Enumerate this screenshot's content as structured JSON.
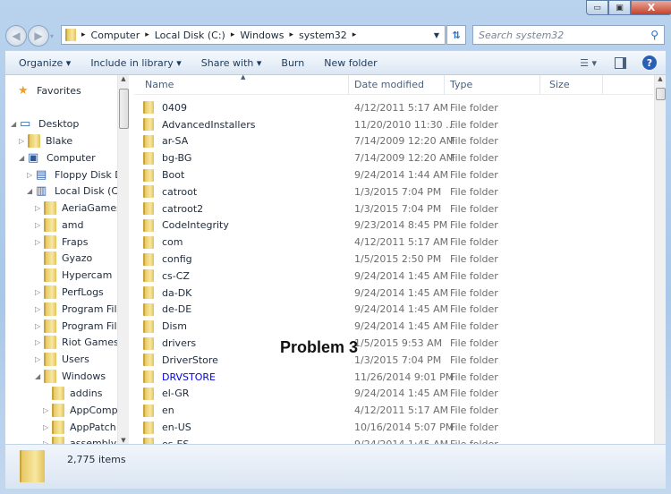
{
  "window": {
    "minimize": "▭",
    "maximize": "▣",
    "close": "X"
  },
  "address": {
    "crumbs": [
      "Computer",
      "Local Disk (C:)",
      "Windows",
      "system32"
    ]
  },
  "search": {
    "placeholder": "Search system32"
  },
  "toolbar": {
    "organize": "Organize ▾",
    "include": "Include in library ▾",
    "share": "Share with ▾",
    "burn": "Burn",
    "new_folder": "New folder"
  },
  "columns": {
    "name": "Name",
    "date": "Date modified",
    "type": "Type",
    "size": "Size"
  },
  "tree": [
    {
      "label": "Favorites",
      "indent": 0,
      "arrow": "",
      "icon": "star"
    },
    {
      "label": "Desktop",
      "indent": 0,
      "arrow": "◢",
      "icon": "desktop"
    },
    {
      "label": "Blake",
      "indent": 1,
      "arrow": "▷",
      "icon": "user"
    },
    {
      "label": "Computer",
      "indent": 1,
      "arrow": "◢",
      "icon": "computer"
    },
    {
      "label": "Floppy Disk Dri",
      "indent": 2,
      "arrow": "▷",
      "icon": "floppy"
    },
    {
      "label": "Local Disk (C:)",
      "indent": 2,
      "arrow": "◢",
      "icon": "disk"
    },
    {
      "label": "AeriaGames",
      "indent": 3,
      "arrow": "▷",
      "icon": "folder"
    },
    {
      "label": "amd",
      "indent": 3,
      "arrow": "▷",
      "icon": "folder"
    },
    {
      "label": "Fraps",
      "indent": 3,
      "arrow": "▷",
      "icon": "folder"
    },
    {
      "label": "Gyazo",
      "indent": 3,
      "arrow": "",
      "icon": "folder"
    },
    {
      "label": "Hypercam",
      "indent": 3,
      "arrow": "",
      "icon": "folder"
    },
    {
      "label": "PerfLogs",
      "indent": 3,
      "arrow": "▷",
      "icon": "folder"
    },
    {
      "label": "Program Files",
      "indent": 3,
      "arrow": "▷",
      "icon": "folder"
    },
    {
      "label": "Program Files",
      "indent": 3,
      "arrow": "▷",
      "icon": "folder"
    },
    {
      "label": "Riot Games",
      "indent": 3,
      "arrow": "▷",
      "icon": "folder"
    },
    {
      "label": "Users",
      "indent": 3,
      "arrow": "▷",
      "icon": "folder"
    },
    {
      "label": "Windows",
      "indent": 3,
      "arrow": "◢",
      "icon": "folder"
    },
    {
      "label": "addins",
      "indent": 4,
      "arrow": "",
      "icon": "folder"
    },
    {
      "label": "AppCompat",
      "indent": 4,
      "arrow": "▷",
      "icon": "folder"
    },
    {
      "label": "AppPatch",
      "indent": 4,
      "arrow": "▷",
      "icon": "folder"
    },
    {
      "label": "assembly",
      "indent": 4,
      "arrow": "▷",
      "icon": "folder"
    }
  ],
  "files": [
    {
      "name": "0409",
      "date": "4/12/2011 5:17 AM",
      "type": "File folder"
    },
    {
      "name": "AdvancedInstallers",
      "date": "11/20/2010 11:30 ...",
      "type": "File folder"
    },
    {
      "name": "ar-SA",
      "date": "7/14/2009 12:20 AM",
      "type": "File folder"
    },
    {
      "name": "bg-BG",
      "date": "7/14/2009 12:20 AM",
      "type": "File folder"
    },
    {
      "name": "Boot",
      "date": "9/24/2014 1:44 AM",
      "type": "File folder"
    },
    {
      "name": "catroot",
      "date": "1/3/2015 7:04 PM",
      "type": "File folder"
    },
    {
      "name": "catroot2",
      "date": "1/3/2015 7:04 PM",
      "type": "File folder"
    },
    {
      "name": "CodeIntegrity",
      "date": "9/23/2014 8:45 PM",
      "type": "File folder"
    },
    {
      "name": "com",
      "date": "4/12/2011 5:17 AM",
      "type": "File folder"
    },
    {
      "name": "config",
      "date": "1/5/2015 2:50 PM",
      "type": "File folder"
    },
    {
      "name": "cs-CZ",
      "date": "9/24/2014 1:45 AM",
      "type": "File folder"
    },
    {
      "name": "da-DK",
      "date": "9/24/2014 1:45 AM",
      "type": "File folder"
    },
    {
      "name": "de-DE",
      "date": "9/24/2014 1:45 AM",
      "type": "File folder"
    },
    {
      "name": "Dism",
      "date": "9/24/2014 1:45 AM",
      "type": "File folder"
    },
    {
      "name": "drivers",
      "date": "1/5/2015 9:53 AM",
      "type": "File folder"
    },
    {
      "name": "DriverStore",
      "date": "1/3/2015 7:04 PM",
      "type": "File folder"
    },
    {
      "name": "DRVSTORE",
      "date": "11/26/2014 9:01 PM",
      "type": "File folder",
      "color": "#0000ee"
    },
    {
      "name": "el-GR",
      "date": "9/24/2014 1:45 AM",
      "type": "File folder"
    },
    {
      "name": "en",
      "date": "4/12/2011 5:17 AM",
      "type": "File folder"
    },
    {
      "name": "en-US",
      "date": "10/16/2014 5:07 PM",
      "type": "File folder"
    },
    {
      "name": "es-ES",
      "date": "9/24/2014 1:45 AM",
      "type": "File folder"
    }
  ],
  "status": {
    "count": "2,775 items"
  },
  "overlay": {
    "text": "Problem 3"
  }
}
